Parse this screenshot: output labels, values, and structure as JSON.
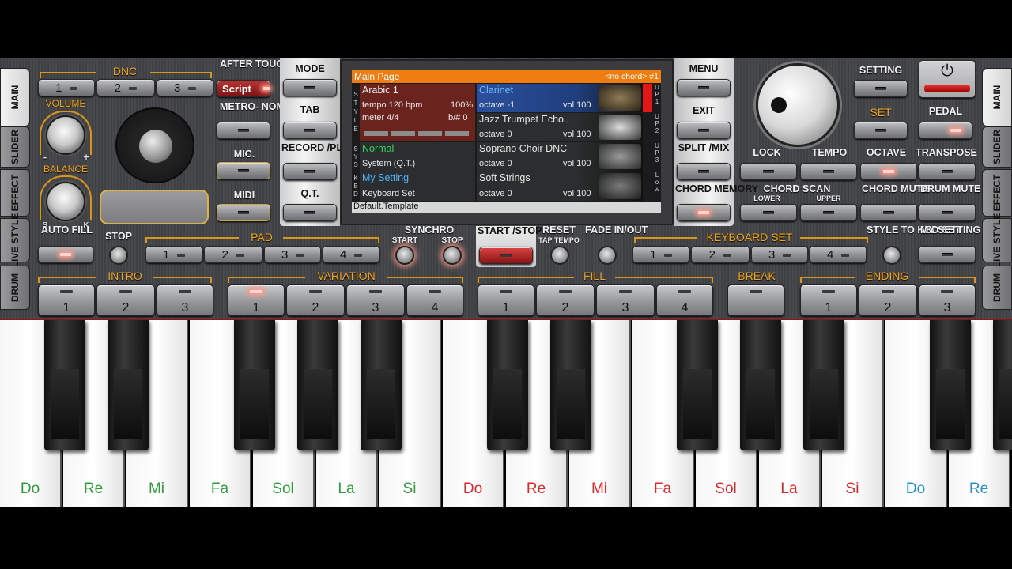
{
  "tabs_left": [
    "MAIN",
    "SLIDER",
    "EFFECT",
    "LIVE STYLE",
    "DRUM"
  ],
  "tabs_right": [
    "MAIN",
    "SLIDER",
    "EFFECT",
    "LIVE STYLE",
    "DRUM"
  ],
  "labels": {
    "dnc": "DNC",
    "after_touch": "AFTER TOUCH",
    "script": "Script",
    "volume": "VOLUME",
    "balance": "BALANCE",
    "metronome": "METRO- NOME",
    "mic": "MIC.",
    "midi": "MIDI",
    "mode": "MODE",
    "tab": "TAB",
    "record_play": "RECORD /PLAY",
    "qt": "Q.T.",
    "menu": "MENU",
    "exit": "EXIT",
    "split_mix": "SPLIT /MIX",
    "chord_memory": "CHORD MEMORY",
    "setting": "SETTING",
    "set": "SET",
    "pedal": "PEDAL",
    "lock": "LOCK",
    "tempo": "TEMPO",
    "octave": "OCTAVE",
    "transpose": "TRANSPOSE",
    "chord_scan": "CHORD SCAN",
    "lower": "LOWER",
    "upper": "UPPER",
    "chord_mute": "CHORD MUTE",
    "drum_mute": "DRUM MUTE",
    "auto_fill": "AUTO FILL",
    "stop": "STOP",
    "pad": "PAD",
    "synchro": "SYNCHRO",
    "sync_start": "START",
    "sync_stop": "STOP",
    "start_stop": "START /STOP",
    "reset": "RESET",
    "tap_tempo": "TAP TEMPO",
    "fade": "FADE IN/OUT",
    "keyboard_set": "KEYBOARD SET",
    "style_to_kbd": "STYLE TO KBD SET",
    "my_setting": "MY SETTING",
    "intro": "INTRO",
    "variation": "VARIATION",
    "fill": "FILL",
    "break": "BREAK",
    "ending": "ENDING",
    "bal_s": "S",
    "bal_k": "K",
    "vol_minus": "-",
    "vol_plus": "+"
  },
  "nums4": [
    "1",
    "2",
    "3",
    "4"
  ],
  "nums3": [
    "1",
    "2",
    "3"
  ],
  "screen": {
    "title": "Main Page",
    "chord": "<no chord> #1",
    "style_name": "Arabic 1",
    "tempo": "tempo 120 bpm",
    "percent": "100%",
    "meter": "meter 4/4",
    "bsharp": "b/#  0",
    "side_style": "S T Y L E",
    "side_sys": "S Y S",
    "side_kbd": "K B D",
    "sys_name": "Normal",
    "sys_sub": "System (Q.T.)",
    "kbd_name": "My Setting",
    "kbd_sub": "Keyboard Set",
    "footer": "Default.Template",
    "voices": [
      {
        "name": "Clarinet",
        "octave": "octave -1",
        "vol": "vol 100",
        "side": "U P 1"
      },
      {
        "name": "Jazz Trumpet Echo..",
        "octave": "octave  0",
        "vol": "vol 100",
        "side": "U P 2"
      },
      {
        "name": "Soprano Choir DNC",
        "octave": "octave  0",
        "vol": "vol 100",
        "side": "U P 3"
      },
      {
        "name": "Soft Strings",
        "octave": "octave  0",
        "vol": "vol 100",
        "side": "L o w"
      }
    ]
  },
  "keys": [
    {
      "n": "Do",
      "c": "#2e9a3a"
    },
    {
      "n": "Re",
      "c": "#2e9a3a"
    },
    {
      "n": "Mi",
      "c": "#2e9a3a"
    },
    {
      "n": "Fa",
      "c": "#2e9a3a"
    },
    {
      "n": "Sol",
      "c": "#2e9a3a"
    },
    {
      "n": "La",
      "c": "#2e9a3a"
    },
    {
      "n": "Si",
      "c": "#2e9a3a"
    },
    {
      "n": "Do",
      "c": "#e0262b"
    },
    {
      "n": "Re",
      "c": "#e0262b"
    },
    {
      "n": "Mi",
      "c": "#e0262b"
    },
    {
      "n": "Fa",
      "c": "#e0262b"
    },
    {
      "n": "Sol",
      "c": "#e0262b"
    },
    {
      "n": "La",
      "c": "#e0262b"
    },
    {
      "n": "Si",
      "c": "#e0262b"
    },
    {
      "n": "Do",
      "c": "#2a8fc4"
    },
    {
      "n": "Re",
      "c": "#2a8fc4"
    }
  ],
  "colors": {
    "accent": "#f4a51c",
    "header_bar": "#f07d12"
  }
}
